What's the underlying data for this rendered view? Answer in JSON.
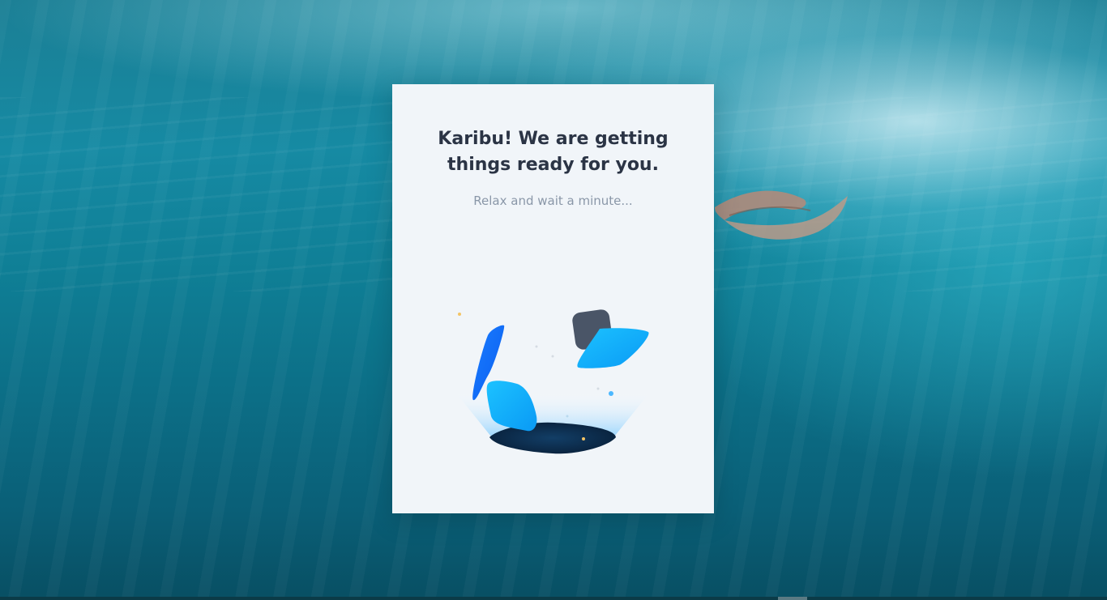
{
  "loading_card": {
    "title": "Karibu! We are getting things ready for you.",
    "subtitle": "Relax and wait a minute..."
  },
  "colors": {
    "card_background": "#f1f5f9",
    "title_color": "#2b3445",
    "subtitle_color": "#8a97a8",
    "accent_blue": "#0a6cff",
    "accent_light_blue": "#12b0ff",
    "accent_slate": "#4a5567",
    "hole_dark": "#0d2b4a"
  },
  "icons": {
    "loading_illustration": "floating-tiles-illustration"
  }
}
